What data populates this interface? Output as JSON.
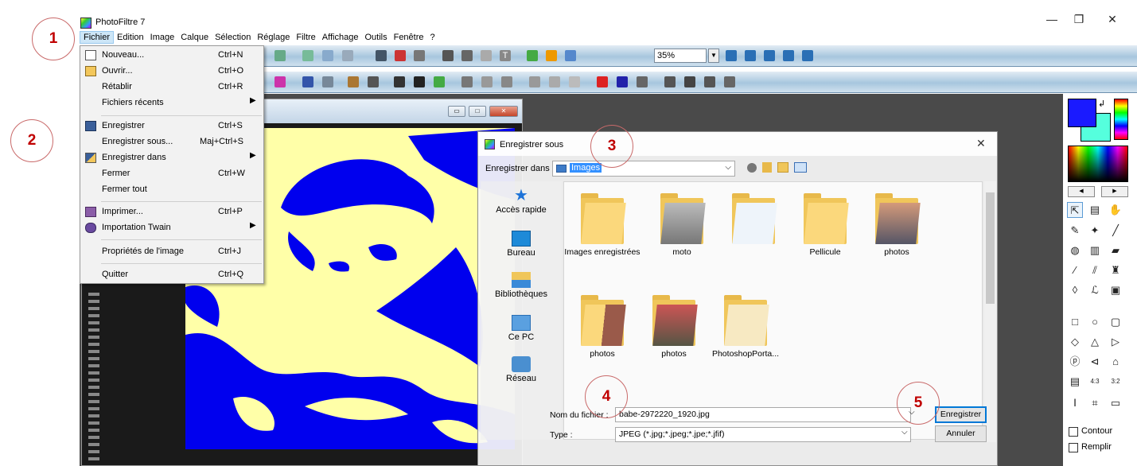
{
  "app": {
    "title": "PhotoFiltre 7",
    "window_controls": {
      "minimize": "—",
      "maximize": "❐",
      "close": "✕"
    }
  },
  "menubar": [
    "Fichier",
    "Edition",
    "Image",
    "Calque",
    "Sélection",
    "Réglage",
    "Filtre",
    "Affichage",
    "Outils",
    "Fenêtre",
    "?"
  ],
  "toolbar": {
    "zoom": "35%"
  },
  "file_menu": {
    "items": [
      {
        "label": "Nouveau...",
        "shortcut": "Ctrl+N",
        "icon": "new-document-icon"
      },
      {
        "label": "Ouvrir...",
        "shortcut": "Ctrl+O",
        "icon": "open-folder-icon"
      },
      {
        "label": "Rétablir",
        "shortcut": "Ctrl+R"
      },
      {
        "label": "Fichiers récents",
        "submenu": true
      },
      {
        "label": "Enregistrer",
        "shortcut": "Ctrl+S",
        "icon": "save-disk-icon"
      },
      {
        "label": "Enregistrer sous...",
        "shortcut": "Maj+Ctrl+S"
      },
      {
        "label": "Enregistrer dans",
        "submenu": true,
        "icon": "save-in-icon"
      },
      {
        "label": "Fermer",
        "shortcut": "Ctrl+W"
      },
      {
        "label": "Fermer tout"
      },
      {
        "label": "Imprimer...",
        "shortcut": "Ctrl+P",
        "icon": "printer-icon"
      },
      {
        "label": "Importation Twain",
        "submenu": true,
        "icon": "scanner-icon"
      },
      {
        "label": "Propriétés de l'image",
        "shortcut": "Ctrl+J"
      },
      {
        "label": "Quitter",
        "shortcut": "Ctrl+Q"
      }
    ]
  },
  "dialog": {
    "title": "Enregistrer sous",
    "save_in_label": "Enregistrer dans :",
    "save_in_value": "Images",
    "nav": [
      "Accès rapide",
      "Bureau",
      "Bibliothèques",
      "Ce PC",
      "Réseau"
    ],
    "files": [
      {
        "name": ""
      },
      {
        "name": "Images enregistrées"
      },
      {
        "name": "moto"
      },
      {
        "name": ""
      },
      {
        "name": "Pellicule"
      },
      {
        "name": "photos"
      },
      {
        "name": "photos"
      },
      {
        "name": "photos"
      },
      {
        "name": "PhotoshopPorta..."
      }
    ],
    "filename_label": "Nom du fichier :",
    "filename_value": "babe-2972220_1920.jpg",
    "type_label": "Type :",
    "type_value": "JPEG (*.jpg;*.jpeg;*.jpe;*.jfif)",
    "save_button": "Enregistrer",
    "cancel_button": "Annuler"
  },
  "palette": {
    "contour_label": "Contour",
    "remplir_label": "Remplir",
    "fg_color": "#1a1aff",
    "bg_color": "#55ffdd"
  },
  "markers": [
    "1",
    "2",
    "3",
    "4",
    "5"
  ],
  "colors": {
    "image_bg": "#ffffa8",
    "image_fg": "#0000ee",
    "marker": "#c00000"
  }
}
